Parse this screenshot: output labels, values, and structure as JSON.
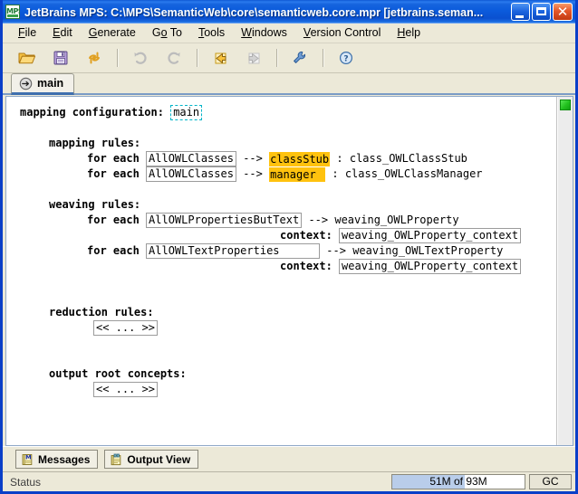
{
  "window": {
    "title": "JetBrains MPS: C:\\MPS\\SemanticWeb\\core\\semanticweb.core.mpr  [jetbrains.seman...",
    "app_icon_text": "MPS",
    "minimize_label": "_",
    "maximize_label": "□",
    "close_label": "✕"
  },
  "menubar": {
    "items": [
      {
        "label": "File",
        "mnemonic": "F"
      },
      {
        "label": "Edit",
        "mnemonic": "E"
      },
      {
        "label": "Generate",
        "mnemonic": "G"
      },
      {
        "label": "Go To",
        "mnemonic": "o"
      },
      {
        "label": "Tools",
        "mnemonic": "T"
      },
      {
        "label": "Windows",
        "mnemonic": "W"
      },
      {
        "label": "Version Control",
        "mnemonic": "V"
      },
      {
        "label": "Help",
        "mnemonic": "H"
      }
    ]
  },
  "toolbar": {
    "buttons": [
      {
        "name": "open-folder-icon",
        "tooltip": "Open",
        "enabled": true
      },
      {
        "name": "save-icon",
        "tooltip": "Save",
        "enabled": true
      },
      {
        "name": "refresh-icon",
        "tooltip": "Refresh",
        "enabled": true
      },
      {
        "name": "undo-icon",
        "tooltip": "Undo",
        "enabled": false
      },
      {
        "name": "redo-icon",
        "tooltip": "Redo",
        "enabled": false
      },
      {
        "name": "back-icon",
        "tooltip": "Back",
        "enabled": true
      },
      {
        "name": "forward-icon",
        "tooltip": "Forward",
        "enabled": false
      },
      {
        "name": "settings-wrench-icon",
        "tooltip": "Settings",
        "enabled": true
      },
      {
        "name": "help-icon",
        "tooltip": "Help",
        "enabled": true
      }
    ]
  },
  "tabs": [
    {
      "label": "main",
      "icon": "arrow-circle-icon",
      "active": true
    }
  ],
  "editor": {
    "header_keyword": "mapping configuration:",
    "header_value": "main",
    "sections": {
      "mapping_rules": {
        "label": "mapping rules:",
        "for_each_label": "for each",
        "arrow": "-->",
        "colon": ":",
        "rules": [
          {
            "source": "AllOWLClasses",
            "target": "classStub",
            "template": "class_OWLClassStub"
          },
          {
            "source": "AllOWLClasses",
            "target": "manager",
            "template": "class_OWLClassManager"
          }
        ]
      },
      "weaving_rules": {
        "label": "weaving rules:",
        "for_each_label": "for each",
        "arrow": "-->",
        "context_label": "context:",
        "rules": [
          {
            "source": "AllOWLPropertiesButText",
            "target": "weaving_OWLProperty",
            "context": "weaving_OWLProperty_context"
          },
          {
            "source": "AllOWLTextProperties",
            "target": "weaving_OWLTextProperty",
            "context": "weaving_OWLProperty_context"
          }
        ]
      },
      "reduction_rules": {
        "label": "reduction rules:",
        "placeholder": "<< ... >>"
      },
      "output_root_concepts": {
        "label": "output root concepts:",
        "placeholder": "<< ... >>"
      }
    },
    "gutter_marker_color": "#22c11e"
  },
  "bottom_bar": {
    "buttons": [
      {
        "label": "Messages",
        "icon": "messages-icon"
      },
      {
        "label": "Output View",
        "icon": "output-view-icon"
      }
    ]
  },
  "statusbar": {
    "status_text": "Status",
    "memory_label": "51M of 93M",
    "memory_used_mb": 51,
    "memory_total_mb": 93,
    "gc_label": "GC"
  },
  "colors": {
    "titlebar_blue": "#0B5BDC",
    "window_border": "#0A3FC8",
    "highlight_amber": "#ffc20e",
    "selection_cyan": "#00b4c8",
    "chrome_beige": "#ece9d8"
  }
}
